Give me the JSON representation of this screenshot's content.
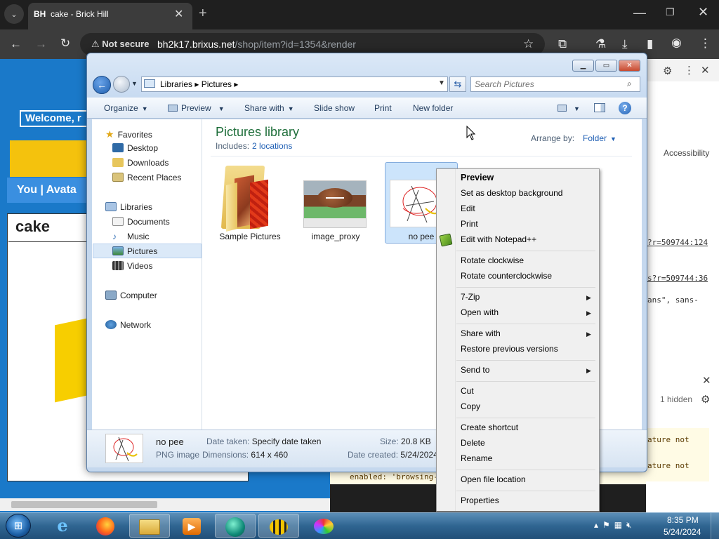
{
  "browser": {
    "tab_favicon": "BH",
    "tab_title": "cake - Brick Hill",
    "security_label": "Not secure",
    "url_host": "bh2k17.brixus.net",
    "url_path": "/shop/item?id=1354&render"
  },
  "webpage": {
    "welcome": "Welcome, r",
    "nav_text": "You  |  Avata",
    "card_title": "cake"
  },
  "devtools": {
    "tab_accessibility": "Accessibility",
    "code_line_1": "?r=509744:124",
    "code_line_2": "s?r=509744:36",
    "code_line_3": "ans\", sans-",
    "hidden_count": "1 hidden",
    "warning_1": "ature not",
    "warning_2": "ature not",
    "console_text": "enabled: 'browsing-"
  },
  "explorer": {
    "breadcrumb": "Libraries  ▸  Pictures  ▸",
    "search_placeholder": "Search Pictures",
    "commands": {
      "organize": "Organize",
      "preview": "Preview",
      "share_with": "Share with",
      "slide_show": "Slide show",
      "print": "Print",
      "new_folder": "New folder"
    },
    "nav": {
      "favorites": "Favorites",
      "desktop": "Desktop",
      "downloads": "Downloads",
      "recent_places": "Recent Places",
      "libraries": "Libraries",
      "documents": "Documents",
      "music": "Music",
      "pictures": "Pictures",
      "videos": "Videos",
      "computer": "Computer",
      "network": "Network"
    },
    "library_title": "Pictures library",
    "includes_label": "Includes:",
    "includes_link": "2 locations",
    "arrange_label": "Arrange by:",
    "arrange_value": "Folder",
    "items": [
      {
        "name": "Sample Pictures"
      },
      {
        "name": "image_proxy"
      },
      {
        "name": "no pee"
      }
    ],
    "details": {
      "name": "no pee",
      "type": "PNG image",
      "date_taken_label": "Date taken:",
      "date_taken_value": "Specify date taken",
      "dimensions_label": "Dimensions:",
      "dimensions_value": "614 x 460",
      "size_label": "Size:",
      "size_value": "20.8 KB",
      "date_created_label": "Date created:",
      "date_created_value": "5/24/2024"
    }
  },
  "context_menu": {
    "preview": "Preview",
    "set_desktop_bg": "Set as desktop background",
    "edit": "Edit",
    "print": "Print",
    "edit_npp": "Edit with Notepad++",
    "rotate_cw": "Rotate clockwise",
    "rotate_ccw": "Rotate counterclockwise",
    "seven_zip": "7-Zip",
    "open_with": "Open with",
    "share_with": "Share with",
    "restore_versions": "Restore previous versions",
    "send_to": "Send to",
    "cut": "Cut",
    "copy": "Copy",
    "create_shortcut": "Create shortcut",
    "delete": "Delete",
    "rename": "Rename",
    "open_file_location": "Open file location",
    "properties": "Properties"
  },
  "taskbar": {
    "time": "8:35 PM",
    "date": "5/24/2024"
  }
}
